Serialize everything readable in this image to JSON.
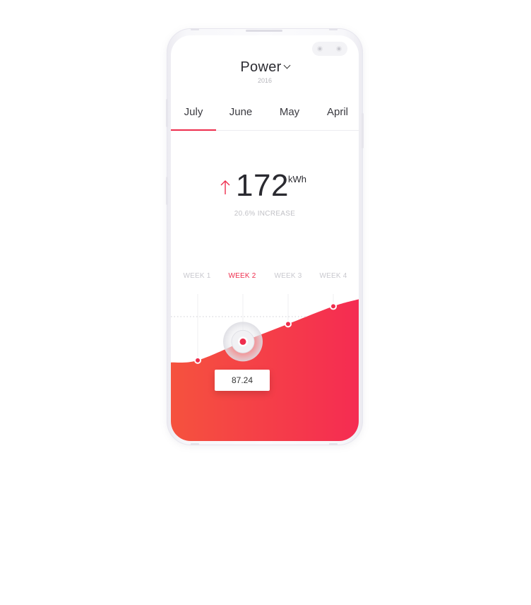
{
  "header": {
    "title": "Power",
    "year": "2016"
  },
  "tabs": [
    {
      "label": "July",
      "active": true
    },
    {
      "label": "June",
      "active": false
    },
    {
      "label": "May",
      "active": false
    },
    {
      "label": "April",
      "active": false
    }
  ],
  "stat": {
    "value": "172",
    "unit": "kWh",
    "change_text": "20.6% INCREASE"
  },
  "weeks": [
    {
      "label": "WEEK 1",
      "active": false
    },
    {
      "label": "WEEK 2",
      "active": true
    },
    {
      "label": "WEEK 3",
      "active": false
    },
    {
      "label": "WEEK 4",
      "active": false
    }
  ],
  "tooltip": {
    "value": "87.24"
  },
  "colors": {
    "accent": "#ee2d4d",
    "gradient_start": "#f5523e",
    "gradient_end": "#f52c52",
    "text_dark": "#2a2a30",
    "text_muted": "#c1c1c6"
  },
  "chart_data": {
    "type": "area",
    "categories": [
      "WEEK 1",
      "WEEK 2",
      "WEEK 3",
      "WEEK 4"
    ],
    "series": [
      {
        "values": [
          0.45,
          0.63,
          0.8,
          0.97
        ]
      }
    ],
    "highlight_index": 1,
    "highlight_label": "87.24"
  }
}
